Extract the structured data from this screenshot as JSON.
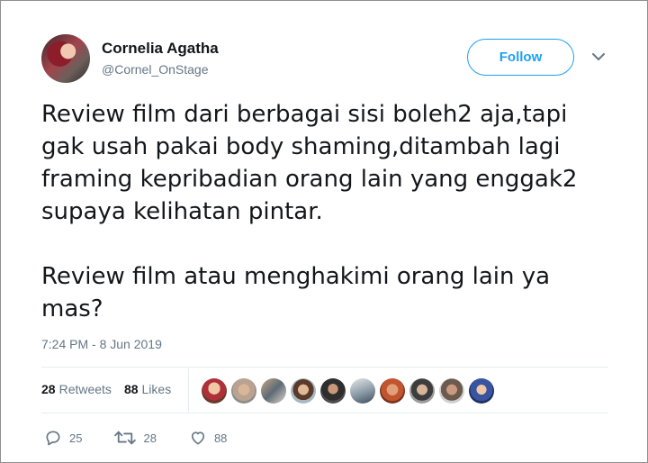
{
  "user": {
    "name": "Cornelia Agatha",
    "handle": "@Cornel_OnStage"
  },
  "follow_button": {
    "label": "Follow"
  },
  "tweet": {
    "paragraphs": [
      "Review film dari berbagai sisi boleh2 aja,tapi gak usah pakai body shaming,ditambah lagi framing kepribadian orang lain yang enggak2 supaya kelihatan pintar.",
      "Review film atau menghakimi orang lain ya mas?"
    ],
    "timestamp": "7:24 PM - 8 Jun 2019"
  },
  "stats": {
    "retweets_count": "28",
    "retweets_label": "Retweets",
    "likes_count": "88",
    "likes_label": "Likes"
  },
  "actions": {
    "replies": "25",
    "retweets": "28",
    "likes": "88"
  },
  "icons": {
    "reply": "reply-icon",
    "retweet": "retweet-icon",
    "like": "heart-icon",
    "caret": "chevron-down-icon"
  },
  "colors": {
    "accent": "#1da1f2",
    "secondary_text": "#657786",
    "primary_text": "#14171a",
    "divider": "#e6ecf0"
  }
}
